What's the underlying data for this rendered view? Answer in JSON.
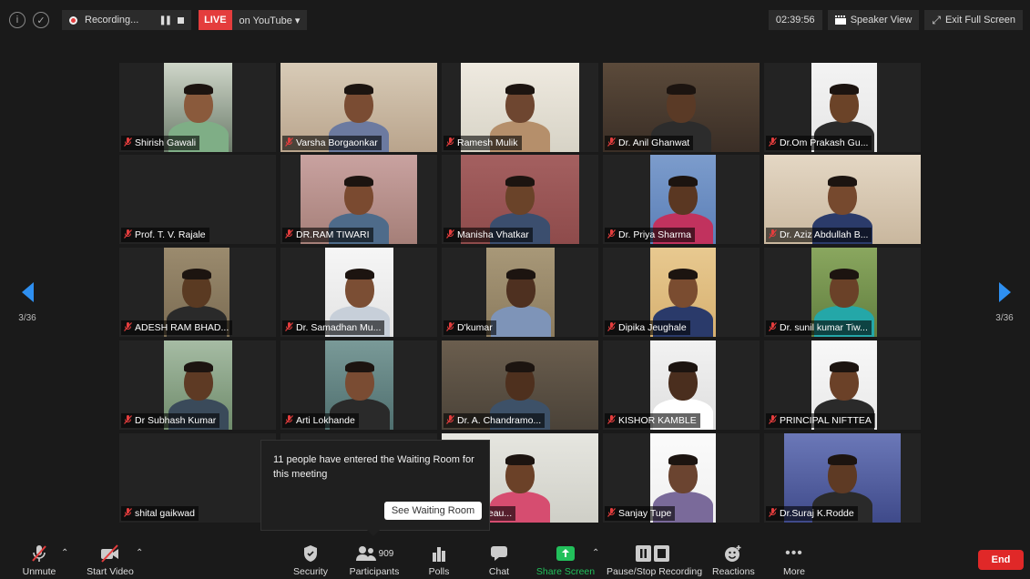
{
  "topbar": {
    "recording_label": "Recording...",
    "live_badge": "LIVE",
    "live_platform": "on YouTube",
    "timer": "02:39:56",
    "speaker_view": "Speaker View",
    "exit_full_screen": "Exit Full Screen"
  },
  "pager": {
    "left_count": "3/36",
    "right_count": "3/36"
  },
  "participants": [
    {
      "name": "Shirish Gawali"
    },
    {
      "name": "Varsha Borgaonkar"
    },
    {
      "name": "Ramesh Mulik"
    },
    {
      "name": "Dr. Anil Ghanwat"
    },
    {
      "name": "Dr.Om Prakash Gu..."
    },
    {
      "name": "Prof. T. V. Rajale"
    },
    {
      "name": "DR.RAM TIWARI"
    },
    {
      "name": "Manisha Vhatkar"
    },
    {
      "name": "Dr. Priya Sharma"
    },
    {
      "name": "Dr. Aziz Abdullah B..."
    },
    {
      "name": "ADESH RAM BHAD..."
    },
    {
      "name": "Dr. Samadhan Mu..."
    },
    {
      "name": "D'kumar"
    },
    {
      "name": "Dipika Jeughale"
    },
    {
      "name": "Dr. sunil kumar Tiw..."
    },
    {
      "name": "Dr Subhash Kumar"
    },
    {
      "name": "Arti Lokhande"
    },
    {
      "name": "Dr. A. Chandramo..."
    },
    {
      "name": "KISHOR KAMBLE"
    },
    {
      "name": "PRINCIPAL NIFTTEA"
    },
    {
      "name": "shital gaikwad"
    },
    {
      "name": ""
    },
    {
      "name": "Betty Beau..."
    },
    {
      "name": "Sanjay Tupe"
    },
    {
      "name": "Dr.Suraj K.Rodde"
    }
  ],
  "waiting_room_toast": {
    "message": "11 people have entered the Waiting Room for this meeting",
    "button": "See Waiting Room"
  },
  "toolbar": {
    "unmute": "Unmute",
    "start_video": "Start Video",
    "security": "Security",
    "participants": "Participants",
    "participants_count": "909",
    "polls": "Polls",
    "chat": "Chat",
    "share_screen": "Share Screen",
    "pause_stop_recording": "Pause/Stop Recording",
    "reactions": "Reactions",
    "more": "More",
    "end": "End"
  },
  "colors": {
    "accent": "#2e8ff0",
    "live": "#e43d3d",
    "share": "#22c05b",
    "end": "#e02828"
  }
}
